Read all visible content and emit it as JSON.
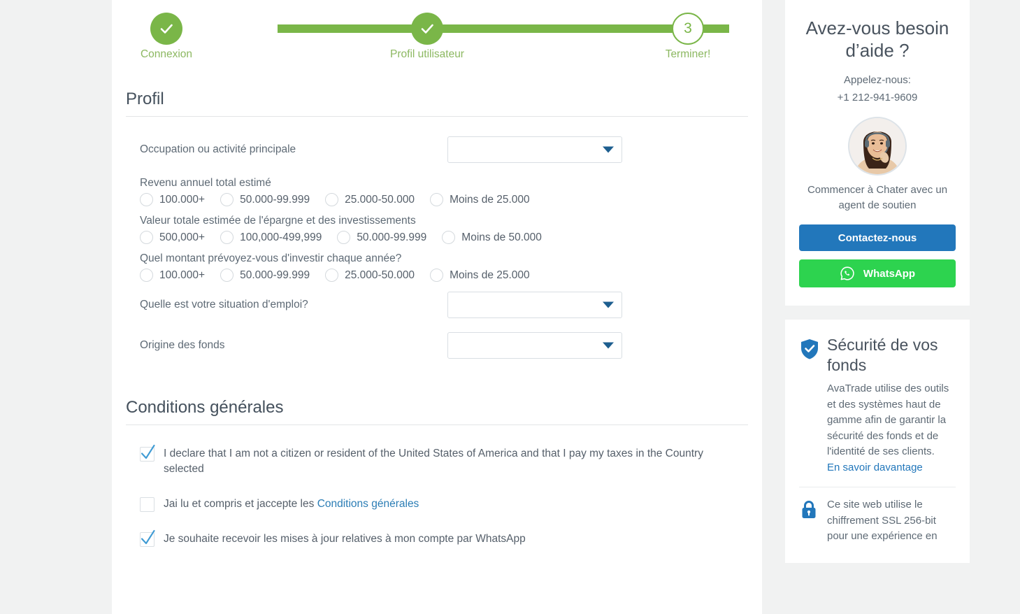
{
  "stepper": {
    "steps": [
      {
        "label": "Connexion",
        "state": "done",
        "number": "1"
      },
      {
        "label": "Profil utilisateur",
        "state": "done",
        "number": "2"
      },
      {
        "label": "Terminer!",
        "state": "current",
        "number": "3"
      }
    ]
  },
  "profile_section": {
    "title": "Profil",
    "occupation": {
      "label": "Occupation ou activité principale",
      "value": "",
      "placeholder": ""
    },
    "employment": {
      "label": "Quelle est votre situation d'emploi?",
      "value": "",
      "placeholder": ""
    },
    "funds_origin": {
      "label": "Origine des fonds",
      "value": "",
      "placeholder": ""
    },
    "radio_groups": [
      {
        "question": "Revenu annuel total estimé",
        "options": [
          "100.000+",
          "50.000-99.999",
          "25.000-50.000",
          "Moins de 25.000"
        ],
        "selected": -1
      },
      {
        "question": "Valeur totale estimée de l'épargne et des investissements",
        "options": [
          "500,000+",
          "100,000-499,999",
          "50.000-99.999",
          "Moins de 50.000"
        ],
        "selected": -1
      },
      {
        "question": "Quel montant prévoyez-vous d'investir chaque année?",
        "options": [
          "100.000+",
          "50.000-99.999",
          "25.000-50.000",
          "Moins de 25.000"
        ],
        "selected": -1
      }
    ]
  },
  "terms_section": {
    "title": "Conditions générales",
    "checkboxes": [
      {
        "text": "I declare that I am not a citizen or resident of the United States of America and that I pay my taxes in the Country selected",
        "checked": true,
        "link_text": "",
        "text_after": ""
      },
      {
        "text": "Jai lu et compris et jaccepte les ",
        "checked": false,
        "link_text": "Conditions générales",
        "text_after": ""
      },
      {
        "text": "Je souhaite recevoir les mises à jour relatives à mon compte par WhatsApp",
        "checked": true,
        "link_text": "",
        "text_after": ""
      }
    ]
  },
  "sidebar": {
    "help": {
      "title": "Avez-vous besoin d’aide ?",
      "call_label": "Appelez-nous:",
      "phone": "+1 212-941-9609",
      "chat_text": "Commencer à Chater avec un agent de soutien",
      "contact_button": "Contactez-nous",
      "whatsapp_button": "WhatsApp"
    },
    "security": {
      "title": "Sécurité de vos fonds",
      "body": "AvaTrade utilise des outils et des systèmes haut de gamme afin de garantir la sécurité des fonds et de l'identité de ses clients.",
      "link": "En savoir davantage",
      "ssl_text": "Ce site web utilise le chiffrement SSL 256-bit pour une expérience en"
    }
  },
  "colors": {
    "green": "#7ab648",
    "step_label_green": "#8cb861",
    "blue": "#2277bb",
    "whatsapp_green": "#2dd34f",
    "arrow_blue": "#1d5e8f",
    "text_dark": "#49535e",
    "text_body": "#5e6a75",
    "page_bg": "#f1f2f2"
  }
}
